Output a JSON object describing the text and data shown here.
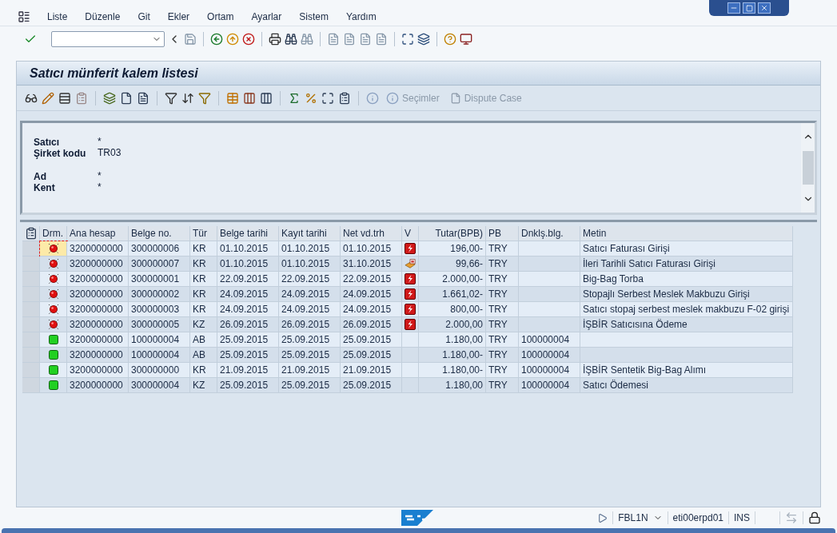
{
  "menu": [
    {
      "label": "Liste"
    },
    {
      "label": "Düzenle"
    },
    {
      "label": "Git"
    },
    {
      "label": "Ekler"
    },
    {
      "label": "Ortam"
    },
    {
      "label": "Ayarlar"
    },
    {
      "label": "Sistem"
    },
    {
      "label": "Yardım"
    }
  ],
  "title": "Satıcı münferit kalem listesi",
  "app_toolbar": {
    "buttons": [
      {
        "label": "Seçimler",
        "disabled": true
      },
      {
        "label": "Dispute Case",
        "disabled": true
      }
    ]
  },
  "header_groups": [
    [
      {
        "label": "Satıcı",
        "value": "*"
      },
      {
        "label": "Şirket kodu",
        "value": "TR03"
      }
    ],
    [
      {
        "label": "Ad",
        "value": "*"
      },
      {
        "label": "Kent",
        "value": "*"
      }
    ]
  ],
  "table": {
    "columns": [
      {
        "label": "Drm."
      },
      {
        "label": "Ana hesap"
      },
      {
        "label": "Belge no."
      },
      {
        "label": "Tür"
      },
      {
        "label": "Belge tarihi"
      },
      {
        "label": "Kayıt tarihi"
      },
      {
        "label": "Net vd.trh"
      },
      {
        "label": "V"
      },
      {
        "label": "Tutar(BPB)"
      },
      {
        "label": "PB"
      },
      {
        "label": "Dnklş.blg."
      },
      {
        "label": "Metin"
      }
    ],
    "rows": [
      {
        "cleared": false,
        "focused": true,
        "account": "3200000000",
        "doc_no": "300000006",
        "type": "KR",
        "doc_date": "01.10.2015",
        "post_date": "01.10.2015",
        "due_date": "01.10.2015",
        "due": {
          "kind": "overdue"
        },
        "amount": "196,00-",
        "currency": "TRY",
        "text": "Satıcı Faturası Girişi"
      },
      {
        "cleared": false,
        "focused": false,
        "account": "3200000000",
        "doc_no": "300000007",
        "type": "KR",
        "doc_date": "01.10.2015",
        "post_date": "01.10.2015",
        "due_date": "31.10.2015",
        "due": {
          "kind": "future"
        },
        "amount": "99,66-",
        "currency": "TRY",
        "text": "İleri Tarihli Satıcı Faturası Girişi"
      },
      {
        "cleared": false,
        "focused": false,
        "account": "3200000000",
        "doc_no": "300000001",
        "type": "KR",
        "doc_date": "22.09.2015",
        "post_date": "22.09.2015",
        "due_date": "22.09.2015",
        "due": {
          "kind": "overdue"
        },
        "amount": "2.000,00-",
        "currency": "TRY",
        "text": "Big-Bag Torba"
      },
      {
        "cleared": false,
        "focused": false,
        "account": "3200000000",
        "doc_no": "300000002",
        "type": "KR",
        "doc_date": "24.09.2015",
        "post_date": "24.09.2015",
        "due_date": "24.09.2015",
        "due": {
          "kind": "overdue"
        },
        "amount": "1.661,02-",
        "currency": "TRY",
        "text": "Stopajlı Serbest Meslek Makbuzu Girişi"
      },
      {
        "cleared": false,
        "focused": false,
        "account": "3200000000",
        "doc_no": "300000003",
        "type": "KR",
        "doc_date": "24.09.2015",
        "post_date": "24.09.2015",
        "due_date": "24.09.2015",
        "due": {
          "kind": "overdue"
        },
        "amount": "800,00-",
        "currency": "TRY",
        "text": "Satıcı stopaj serbest meslek makbuzu F-02 girişi"
      },
      {
        "cleared": false,
        "focused": false,
        "account": "3200000000",
        "doc_no": "300000005",
        "type": "KZ",
        "doc_date": "26.09.2015",
        "post_date": "26.09.2015",
        "due_date": "26.09.2015",
        "due": {
          "kind": "overdue"
        },
        "amount": "2.000,00",
        "currency": "TRY",
        "text": "İŞBİR Satıcısına Ödeme"
      },
      {
        "cleared": true,
        "focused": false,
        "account": "3200000000",
        "doc_no": "100000004",
        "type": "AB",
        "doc_date": "25.09.2015",
        "post_date": "25.09.2015",
        "due_date": "25.09.2015",
        "amount": "1.180,00",
        "currency": "TRY",
        "clearing_doc": "100000004"
      },
      {
        "cleared": true,
        "focused": false,
        "account": "3200000000",
        "doc_no": "100000004",
        "type": "AB",
        "doc_date": "25.09.2015",
        "post_date": "25.09.2015",
        "due_date": "25.09.2015",
        "amount": "1.180,00-",
        "currency": "TRY",
        "clearing_doc": "100000004"
      },
      {
        "cleared": true,
        "focused": false,
        "account": "3200000000",
        "doc_no": "300000000",
        "type": "KR",
        "doc_date": "21.09.2015",
        "post_date": "21.09.2015",
        "due_date": "21.09.2015",
        "amount": "1.180,00-",
        "currency": "TRY",
        "clearing_doc": "100000004",
        "text": "İŞBİR Sentetik Big-Bag Alımı"
      },
      {
        "cleared": true,
        "focused": false,
        "account": "3200000000",
        "doc_no": "300000004",
        "type": "KZ",
        "doc_date": "25.09.2015",
        "post_date": "25.09.2015",
        "due_date": "25.09.2015",
        "amount": "1.180,00",
        "currency": "TRY",
        "clearing_doc": "100000004",
        "text": "Satıcı Ödemesi"
      }
    ]
  },
  "status_bar": {
    "transaction": "FBL1N",
    "server": "eti00erpd01",
    "mode": "INS"
  }
}
